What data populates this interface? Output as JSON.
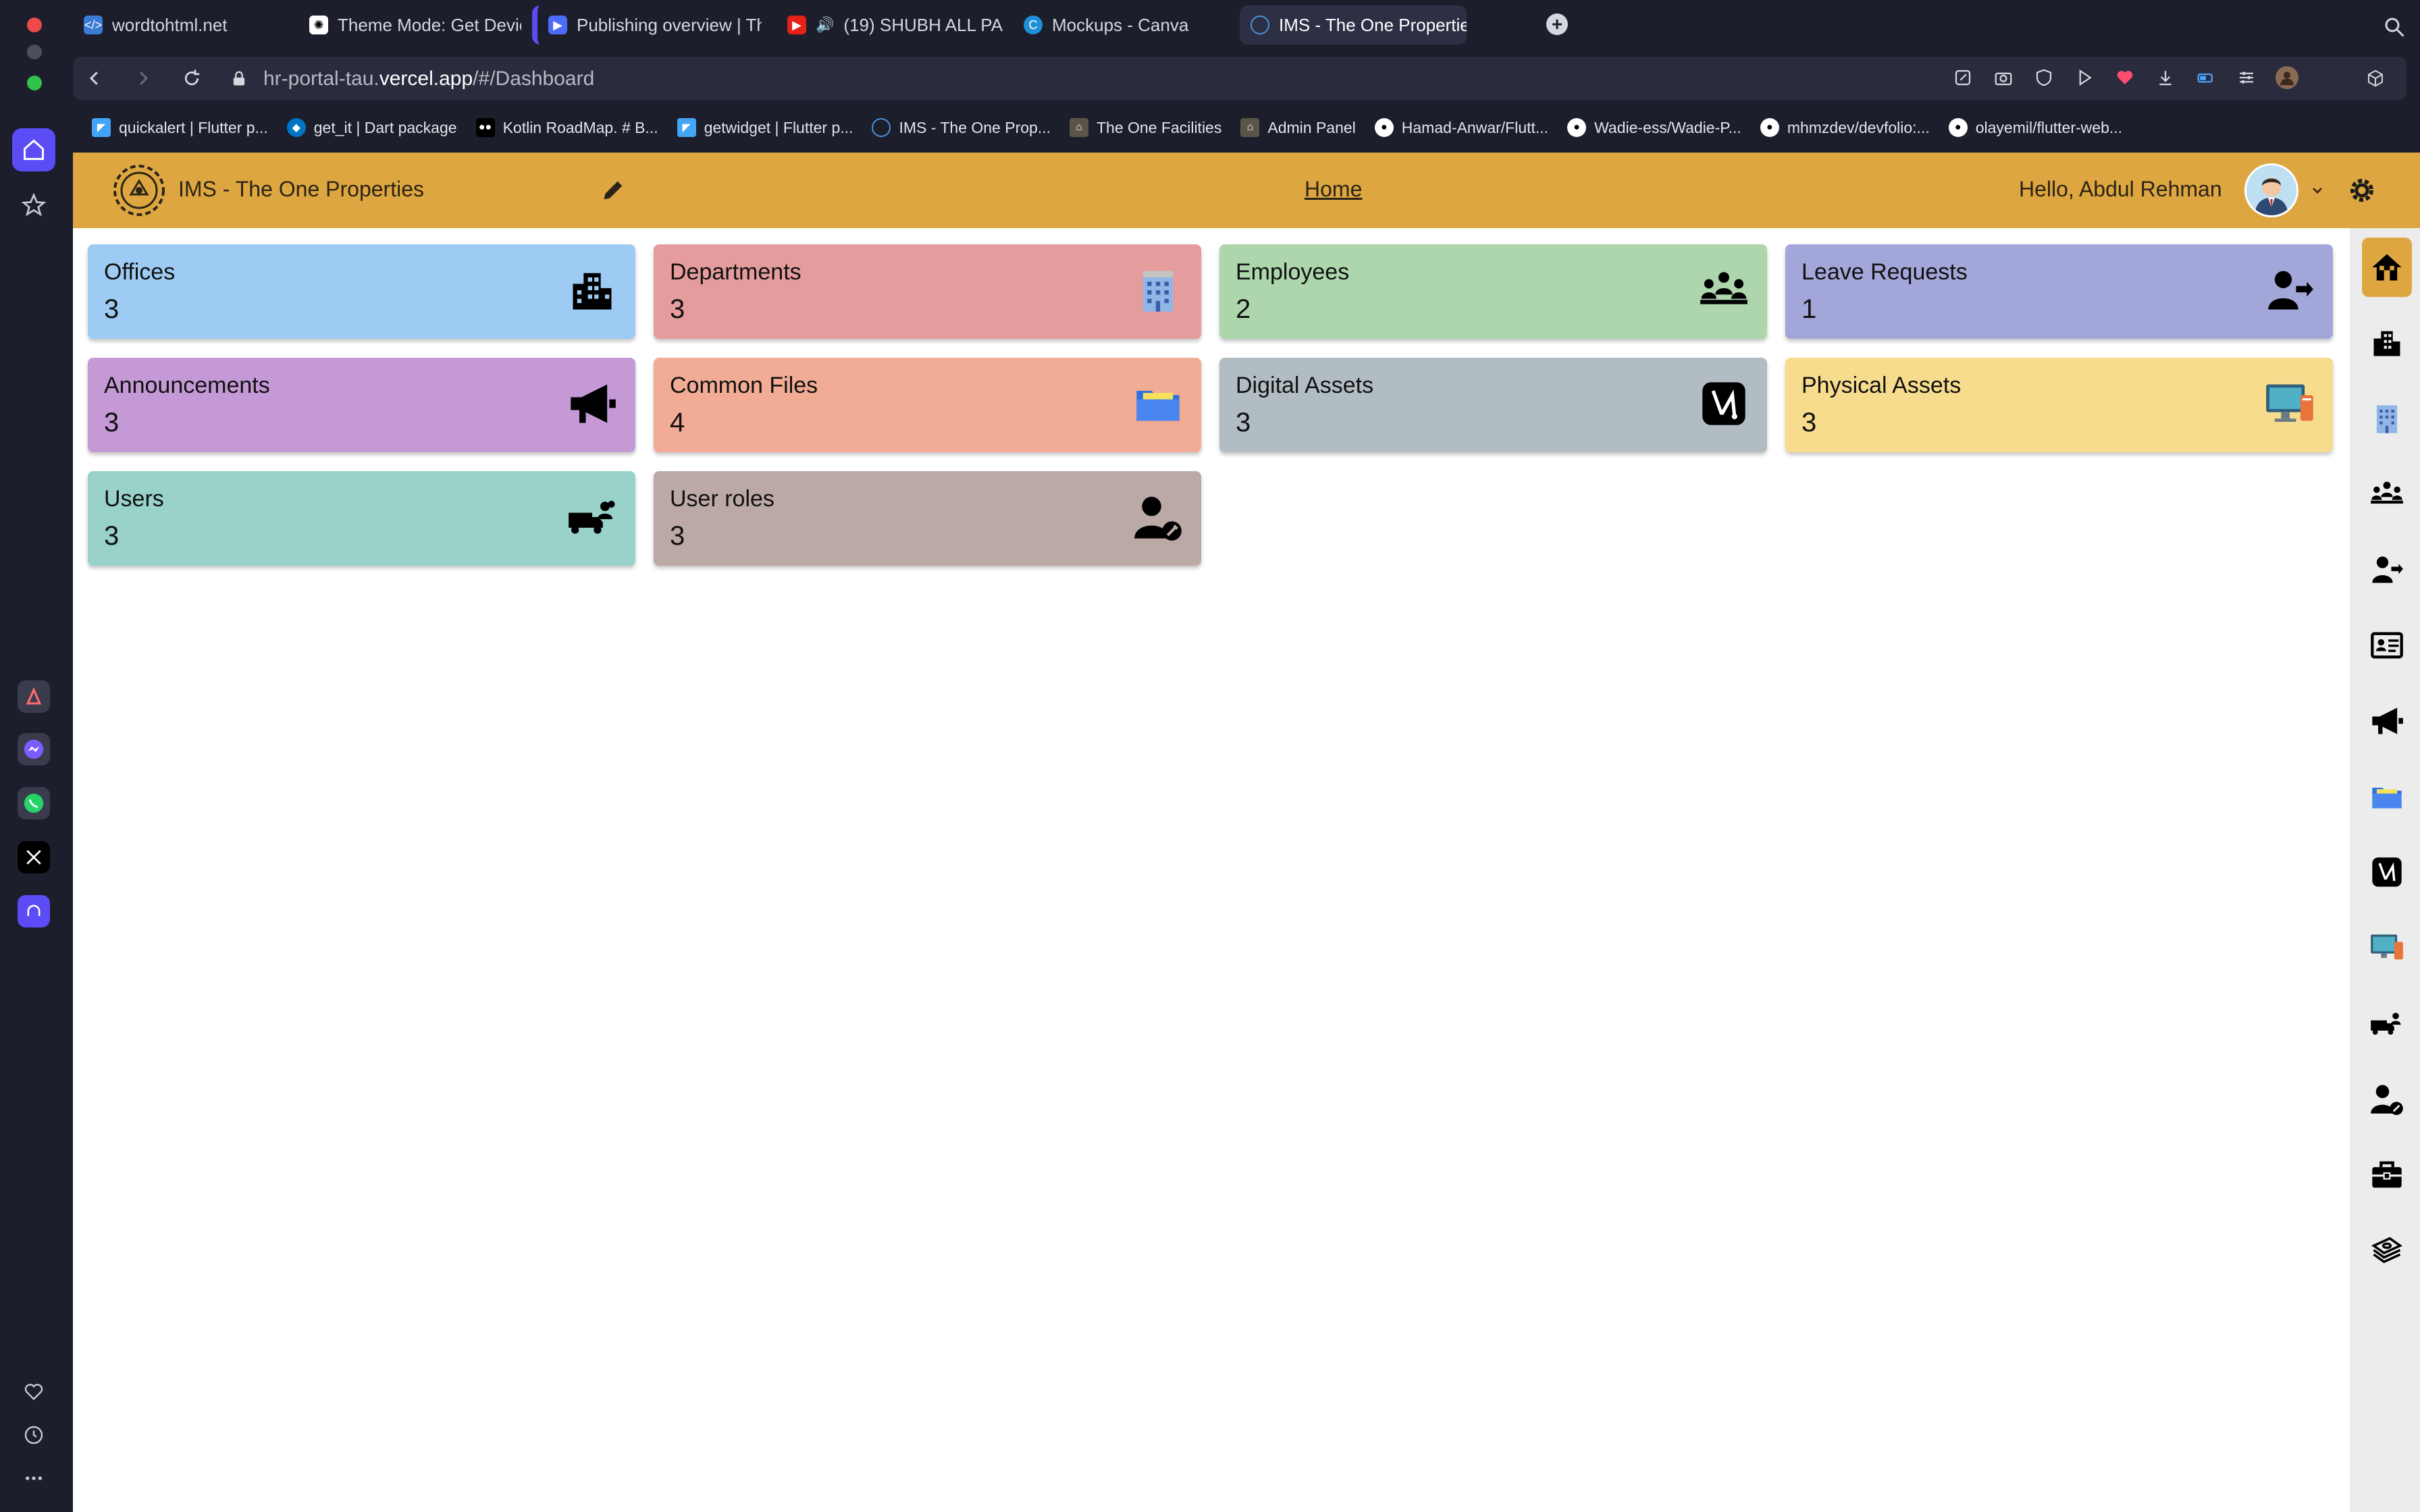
{
  "browser": {
    "tabs": [
      {
        "label": "wordtohtml.net",
        "icon": "wordtohtml-icon",
        "active": false
      },
      {
        "label": "Theme Mode: Get Devic",
        "icon": "chatgpt-icon",
        "active": false
      },
      {
        "label": "Publishing overview | Th",
        "icon": "publishing-icon",
        "active": false
      },
      {
        "label": "(19) SHUBH ALL PA",
        "icon": "youtube-icon",
        "active": false
      },
      {
        "label": "Mockups - Canva",
        "icon": "canva-icon",
        "active": false
      },
      {
        "label": "IMS - The One Propertie",
        "icon": "ims-icon",
        "active": true
      }
    ],
    "url_host_prefix": "hr-portal-tau.",
    "url_host_main": "vercel.app",
    "url_path": "/#/Dashboard",
    "bookmarks": [
      {
        "label": "quickalert | Flutter p...",
        "icon": "flutter-icon"
      },
      {
        "label": "get_it | Dart package",
        "icon": "dart-icon"
      },
      {
        "label": "Kotlin RoadMap. # B...",
        "icon": "medium-icon"
      },
      {
        "label": "getwidget | Flutter p...",
        "icon": "flutter-icon"
      },
      {
        "label": "IMS - The One Prop...",
        "icon": "ims-icon"
      },
      {
        "label": "The One Facilities",
        "icon": "facilities-icon"
      },
      {
        "label": "Admin Panel",
        "icon": "facilities-icon"
      },
      {
        "label": "Hamad-Anwar/Flutt...",
        "icon": "github-icon"
      },
      {
        "label": "Wadie-ess/Wadie-P...",
        "icon": "github-icon"
      },
      {
        "label": "mhmzdev/devfolio:...",
        "icon": "github-icon"
      },
      {
        "label": "olayemil/flutter-web...",
        "icon": "github-icon"
      }
    ]
  },
  "app": {
    "title": "IMS - The One Properties",
    "nav_home": "Home",
    "greeting": "Hello, Abdul Rehman",
    "brand_color": "#dea640"
  },
  "cards": [
    {
      "title": "Offices",
      "count": "3",
      "color": "#9dcbf3",
      "icon": "office-building-icon"
    },
    {
      "title": "Departments",
      "count": "3",
      "color": "#e59c9d",
      "icon": "department-building-icon"
    },
    {
      "title": "Employees",
      "count": "2",
      "color": "#add6ad",
      "icon": "employees-group-icon"
    },
    {
      "title": "Leave Requests",
      "count": "1",
      "color": "#a3a6d8",
      "icon": "leave-request-icon"
    },
    {
      "title": "Announcements",
      "count": "3",
      "color": "#c499d6",
      "icon": "megaphone-icon"
    },
    {
      "title": "Common Files",
      "count": "4",
      "color": "#f2ab95",
      "icon": "folder-icon"
    },
    {
      "title": "Digital Assets",
      "count": "3",
      "color": "#b2bcc3",
      "icon": "digital-asset-icon"
    },
    {
      "title": "Physical Assets",
      "count": "3",
      "color": "#f8dc8e",
      "icon": "computer-icon"
    },
    {
      "title": "Users",
      "count": "3",
      "color": "#98d2c8",
      "icon": "users-truck-icon"
    },
    {
      "title": "User roles",
      "count": "3",
      "color": "#bba9a5",
      "icon": "user-role-icon"
    }
  ],
  "right_nav": [
    "home-icon",
    "office-building-icon",
    "department-building-icon",
    "employees-group-icon",
    "leave-request-icon",
    "id-card-icon",
    "megaphone-icon",
    "folder-icon",
    "digital-asset-icon",
    "computer-icon",
    "users-truck-icon",
    "user-role-icon",
    "briefcase-icon",
    "money-stack-icon"
  ]
}
